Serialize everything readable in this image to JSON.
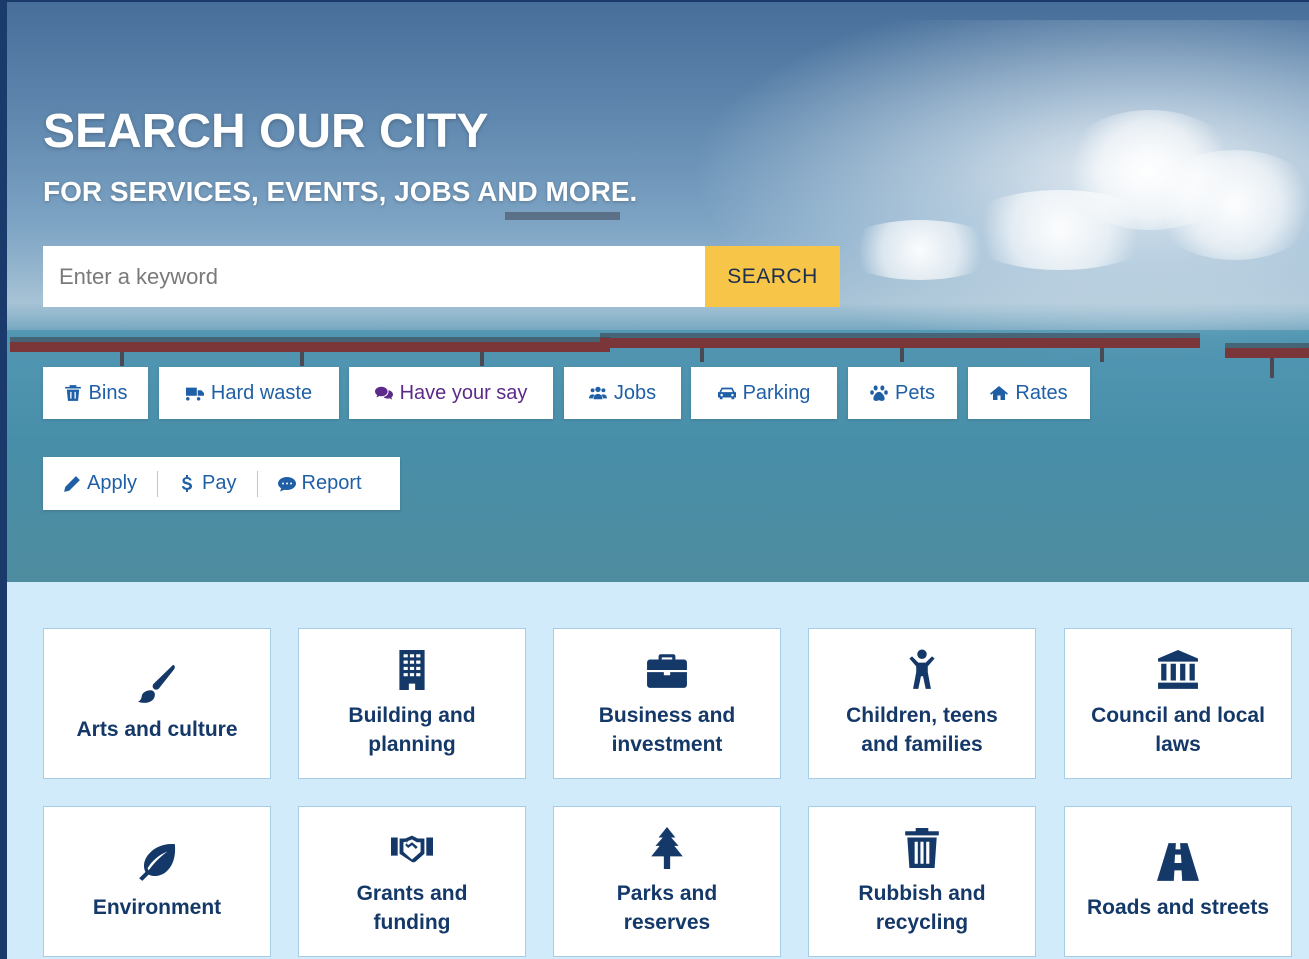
{
  "hero": {
    "title": "SEARCH OUR CITY",
    "subtitle": "FOR SERVICES, EVENTS, JOBS AND MORE."
  },
  "search": {
    "placeholder": "Enter a keyword",
    "button_label": "SEARCH"
  },
  "quick_links": [
    {
      "label": "Bins",
      "icon": "bin-icon"
    },
    {
      "label": "Hard waste",
      "icon": "truck-icon"
    },
    {
      "label": "Have your say",
      "icon": "speech-bubbles-icon"
    },
    {
      "label": "Jobs",
      "icon": "people-icon"
    },
    {
      "label": "Parking",
      "icon": "car-icon"
    },
    {
      "label": "Pets",
      "icon": "paw-icon"
    },
    {
      "label": "Rates",
      "icon": "home-icon"
    }
  ],
  "actions": [
    {
      "label": "Apply",
      "icon": "pencil-icon"
    },
    {
      "label": "Pay",
      "icon": "dollar-icon"
    },
    {
      "label": "Report",
      "icon": "comment-icon"
    }
  ],
  "categories": [
    {
      "label": "Arts and culture",
      "icon": "paintbrush-icon"
    },
    {
      "label": "Building and planning",
      "icon": "building-icon"
    },
    {
      "label": "Business and investment",
      "icon": "briefcase-icon"
    },
    {
      "label": "Children, teens and families",
      "icon": "child-icon"
    },
    {
      "label": "Council and local laws",
      "icon": "institution-icon"
    },
    {
      "label": "Environment",
      "icon": "leaf-icon"
    },
    {
      "label": "Grants and funding",
      "icon": "handshake-icon"
    },
    {
      "label": "Parks and reserves",
      "icon": "tree-icon"
    },
    {
      "label": "Rubbish and recycling",
      "icon": "trash-icon"
    },
    {
      "label": "Roads and streets",
      "icon": "road-icon"
    }
  ],
  "colors": {
    "brand_navy": "#143868",
    "link_blue": "#1f5fa6",
    "search_yellow": "#f7c548",
    "tile_background": "#d2ebfa",
    "have_your_say_purple": "#5c2a8a"
  }
}
